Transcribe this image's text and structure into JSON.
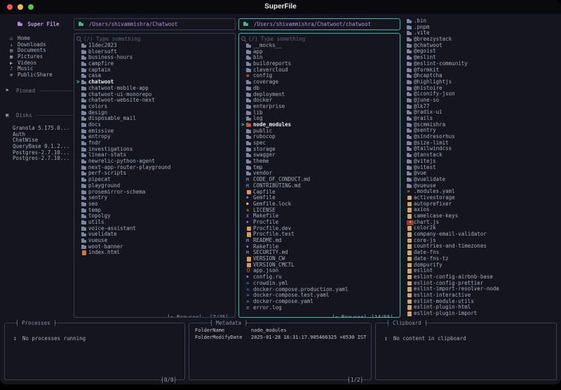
{
  "window": {
    "title": "SuperFile"
  },
  "colors": {
    "accent": "#3eb8ac",
    "path_text": "#b093e6",
    "folder": "#7d87a0",
    "red_folder": "#c2504a",
    "traffic_red": "#f5574e",
    "traffic_yellow": "#f5bd4f",
    "traffic_green": "#57c353"
  },
  "sidebar": {
    "title": "Super File",
    "items": [
      {
        "name": "Home",
        "icon": "home-icon"
      },
      {
        "name": "Downloads",
        "icon": "download-icon"
      },
      {
        "name": "Documents",
        "icon": "document-icon"
      },
      {
        "name": "Pictures",
        "icon": "image-icon"
      },
      {
        "name": "Videos",
        "icon": "video-icon"
      },
      {
        "name": "Music",
        "icon": "music-icon"
      },
      {
        "name": "PublicShare",
        "icon": "share-icon"
      }
    ],
    "sections": [
      {
        "label": "Pinned",
        "icon": "pin-icon"
      },
      {
        "label": "Disks",
        "icon": "disk-icon"
      }
    ],
    "disks": [
      {
        "name": "Granola 5.175.0..."
      },
      {
        "name": "Auth"
      },
      {
        "name": "ChatWise"
      },
      {
        "name": "QueryBase 0.1.2..."
      },
      {
        "name": "Postgres-2.7.10..."
      },
      {
        "name": "Postgres-2.7.10..."
      }
    ]
  },
  "panel1": {
    "path": "/Users/shivammishra/Chatwoot",
    "search_placeholder": "(/) Type something",
    "mode": "Browser",
    "position": "7/35",
    "files": [
      {
        "name": "11dec2023",
        "icon": "folder-icon"
      },
      {
        "name": "bloersoft",
        "icon": "folder-icon"
      },
      {
        "name": "business-hours",
        "icon": "folder-icon"
      },
      {
        "name": "campfire",
        "icon": "folder-icon"
      },
      {
        "name": "captain",
        "icon": "folder-icon"
      },
      {
        "name": "casa",
        "icon": "folder-icon"
      },
      {
        "name": "chatwoot",
        "icon": "folder-icon",
        "selected": true
      },
      {
        "name": "chatwoot-mobile-app",
        "icon": "folder-icon"
      },
      {
        "name": "chatwoot-ui-monorepo",
        "icon": "folder-icon"
      },
      {
        "name": "chatwoot-website-next",
        "icon": "folder-icon"
      },
      {
        "name": "colors",
        "icon": "folder-icon"
      },
      {
        "name": "design",
        "icon": "folder-icon"
      },
      {
        "name": "disposable_mail",
        "icon": "folder-icon"
      },
      {
        "name": "docs",
        "icon": "folder-icon"
      },
      {
        "name": "emissive",
        "icon": "folder-icon"
      },
      {
        "name": "entropy",
        "icon": "folder-icon"
      },
      {
        "name": "fndr",
        "icon": "folder-icon"
      },
      {
        "name": "investigations",
        "icon": "folder-icon"
      },
      {
        "name": "linear-stats",
        "icon": "folder-icon"
      },
      {
        "name": "newrelic-python-agent",
        "icon": "folder-icon"
      },
      {
        "name": "next-app-router-playground",
        "icon": "folder-icon"
      },
      {
        "name": "perf-scripts",
        "icon": "folder-icon"
      },
      {
        "name": "pipecat",
        "icon": "folder-icon"
      },
      {
        "name": "playground",
        "icon": "folder-icon"
      },
      {
        "name": "prosemirror-schema",
        "icon": "folder-icon"
      },
      {
        "name": "sentry",
        "icon": "folder-icon"
      },
      {
        "name": "seo",
        "icon": "folder-icon"
      },
      {
        "name": "temp",
        "icon": "folder-icon"
      },
      {
        "name": "topolgy",
        "icon": "folder-icon"
      },
      {
        "name": "utils",
        "icon": "folder-icon"
      },
      {
        "name": "voice-assistant",
        "icon": "folder-icon"
      },
      {
        "name": "vuelidate",
        "icon": "folder-icon"
      },
      {
        "name": "vueuse",
        "icon": "folder-icon"
      },
      {
        "name": "woot-banner",
        "icon": "folder-icon"
      },
      {
        "name": "index.html",
        "icon": "html-icon"
      }
    ]
  },
  "panel2": {
    "path": "/Users/shivammishra/Chatwoot/chatwoot",
    "search_placeholder": "(/) Type something",
    "mode": "Browser",
    "position": "14/55",
    "files": [
      {
        "name": "__mocks__",
        "icon": "folder-icon"
      },
      {
        "name": "app",
        "icon": "folder-icon"
      },
      {
        "name": "bin",
        "icon": "folder-icon"
      },
      {
        "name": "buildreports",
        "icon": "folder-icon"
      },
      {
        "name": "clevercloud",
        "icon": "folder-icon"
      },
      {
        "name": "config",
        "icon": "gear-icon"
      },
      {
        "name": "coverage",
        "icon": "folder-icon"
      },
      {
        "name": "db",
        "icon": "folder-icon"
      },
      {
        "name": "deployment",
        "icon": "folder-icon"
      },
      {
        "name": "docker",
        "icon": "folder-icon"
      },
      {
        "name": "enterprise",
        "icon": "folder-icon"
      },
      {
        "name": "lib",
        "icon": "folder-icon"
      },
      {
        "name": "log",
        "icon": "folder-icon"
      },
      {
        "name": "node_modules",
        "icon": "red-folder-icon",
        "selected": true
      },
      {
        "name": "public",
        "icon": "folder-icon"
      },
      {
        "name": "rubocop",
        "icon": "folder-icon"
      },
      {
        "name": "spec",
        "icon": "folder-icon"
      },
      {
        "name": "storage",
        "icon": "folder-icon"
      },
      {
        "name": "swagger",
        "icon": "folder-icon"
      },
      {
        "name": "theme",
        "icon": "folder-icon"
      },
      {
        "name": "tmp",
        "icon": "folder-icon"
      },
      {
        "name": "vendor",
        "icon": "folder-icon"
      },
      {
        "name": "CODE_OF_CONDUCT.md",
        "icon": "markdown-icon"
      },
      {
        "name": "CONTRIBUTING.md",
        "icon": "markdown-icon"
      },
      {
        "name": "Capfile",
        "icon": "file-icon"
      },
      {
        "name": "Gemfile",
        "icon": "gem-icon"
      },
      {
        "name": "Gemfile.lock",
        "icon": "lock-icon"
      },
      {
        "name": "LICENSE",
        "icon": "key-icon"
      },
      {
        "name": "Makefile",
        "icon": "makefile-icon"
      },
      {
        "name": "Procfile",
        "icon": "gem-icon"
      },
      {
        "name": "Procfile.dev",
        "icon": "file-icon"
      },
      {
        "name": "Procfile.test",
        "icon": "file-icon"
      },
      {
        "name": "README.md",
        "icon": "markdown-icon"
      },
      {
        "name": "Rakefile",
        "icon": "gem-icon"
      },
      {
        "name": "SECURITY.md",
        "icon": "markdown-icon"
      },
      {
        "name": "VERSION_CW",
        "icon": "file-icon"
      },
      {
        "name": "VERSION_CMCTL",
        "icon": "file-icon"
      },
      {
        "name": "app.json",
        "icon": "json-icon"
      },
      {
        "name": "config.ru",
        "icon": "gem-icon"
      },
      {
        "name": "crowdin.yml",
        "icon": "yaml-icon"
      },
      {
        "name": "docker-compose.production.yaml",
        "icon": "yaml-icon"
      },
      {
        "name": "docker-compose.test.yaml",
        "icon": "yaml-icon"
      },
      {
        "name": "docker-compose.yaml",
        "icon": "yaml-icon"
      },
      {
        "name": "error.log",
        "icon": "log-icon"
      }
    ]
  },
  "preview": {
    "files": [
      {
        "name": ".bin",
        "icon": "folder-icon"
      },
      {
        "name": ".pnpm",
        "icon": "folder-icon"
      },
      {
        "name": ".vite",
        "icon": "folder-icon"
      },
      {
        "name": "@breezystack",
        "icon": "folder-icon"
      },
      {
        "name": "@chatwoot",
        "icon": "folder-icon"
      },
      {
        "name": "@egoist",
        "icon": "folder-icon"
      },
      {
        "name": "@eslint",
        "icon": "folder-icon"
      },
      {
        "name": "@eslint-community",
        "icon": "folder-icon"
      },
      {
        "name": "@formkit",
        "icon": "folder-icon"
      },
      {
        "name": "@hcaptcha",
        "icon": "folder-icon"
      },
      {
        "name": "@highlightjs",
        "icon": "folder-icon"
      },
      {
        "name": "@histoire",
        "icon": "folder-icon"
      },
      {
        "name": "@iconify-json",
        "icon": "folder-icon"
      },
      {
        "name": "@june-so",
        "icon": "folder-icon"
      },
      {
        "name": "@lk77",
        "icon": "folder-icon"
      },
      {
        "name": "@radix-ui",
        "icon": "folder-icon"
      },
      {
        "name": "@rails",
        "icon": "folder-icon"
      },
      {
        "name": "@scmmishra",
        "icon": "folder-icon"
      },
      {
        "name": "@sentry",
        "icon": "folder-icon"
      },
      {
        "name": "@sindresorhus",
        "icon": "folder-icon"
      },
      {
        "name": "@size-limit",
        "icon": "folder-icon"
      },
      {
        "name": "@tailwindcss",
        "icon": "folder-icon"
      },
      {
        "name": "@tanstack",
        "icon": "folder-icon"
      },
      {
        "name": "@vitejs",
        "icon": "folder-icon"
      },
      {
        "name": "@vitest",
        "icon": "folder-icon"
      },
      {
        "name": "@vue",
        "icon": "folder-icon"
      },
      {
        "name": "@vuelidate",
        "icon": "folder-icon"
      },
      {
        "name": "@vueuse",
        "icon": "folder-icon"
      },
      {
        "name": ".modules.yaml",
        "icon": "yaml-orange-icon"
      },
      {
        "name": "activestorage",
        "icon": "pkg-icon"
      },
      {
        "name": "autoprefixer",
        "icon": "pkg-icon"
      },
      {
        "name": "axios",
        "icon": "pkg-icon"
      },
      {
        "name": "camelcase-keys",
        "icon": "pkg-icon"
      },
      {
        "name": "chart.js",
        "icon": "npm-icon"
      },
      {
        "name": "color2k",
        "icon": "pkg-icon"
      },
      {
        "name": "company-email-validator",
        "icon": "pkg-icon"
      },
      {
        "name": "core-js",
        "icon": "pkg-icon"
      },
      {
        "name": "countries-and-timezones",
        "icon": "pkg-icon"
      },
      {
        "name": "date-fns",
        "icon": "pkg-icon"
      },
      {
        "name": "date-fns-tz",
        "icon": "pkg-icon"
      },
      {
        "name": "dompurify",
        "icon": "pkg-icon"
      },
      {
        "name": "eslint",
        "icon": "pkg-icon"
      },
      {
        "name": "eslint-config-airbnb-base",
        "icon": "pkg-icon"
      },
      {
        "name": "eslint-config-prettier",
        "icon": "pkg-icon"
      },
      {
        "name": "eslint-import-resolver-node",
        "icon": "pkg-icon"
      },
      {
        "name": "eslint-interactive",
        "icon": "pkg-icon"
      },
      {
        "name": "eslint-module-utils",
        "icon": "pkg-icon"
      },
      {
        "name": "eslint-plugin-html",
        "icon": "pkg-icon"
      },
      {
        "name": "eslint-plugin-import",
        "icon": "pkg-icon"
      }
    ]
  },
  "processes": {
    "title": "Processes",
    "empty": "No processes running",
    "counter": "0/0"
  },
  "metadata": {
    "title": "Metadata",
    "rows": [
      {
        "key": "FolderName",
        "value": "node_modules"
      },
      {
        "key": "FolderModifyDate",
        "value": "2025-01-28 16:31:17.905466325 +0530 IST"
      }
    ],
    "counter": "1/2"
  },
  "clipboard": {
    "title": "Clipboard",
    "empty": "No content in clipboard"
  },
  "icons": {
    "home-icon": {
      "glyph": "⌂",
      "class": "sic"
    },
    "download-icon": {
      "glyph": "↓",
      "class": "sic"
    },
    "document-icon": {
      "glyph": "▤",
      "class": "sic"
    },
    "image-icon": {
      "glyph": "▦",
      "class": "sic"
    },
    "video-icon": {
      "glyph": "▶",
      "class": "sic"
    },
    "music-icon": {
      "glyph": "♪",
      "class": "sic"
    },
    "share-icon": {
      "glyph": "⊕",
      "class": "sic"
    },
    "pin-icon": {
      "glyph": "⚑",
      "class": "sic"
    },
    "disk-icon": {
      "glyph": "▣",
      "class": "sic"
    },
    "folder-icon": {
      "glyph": "",
      "class": "fold"
    },
    "red-folder-icon": {
      "glyph": "",
      "class": "fold red"
    },
    "gear-icon": {
      "glyph": "⊛",
      "class": "gear"
    },
    "markdown-icon": {
      "glyph": "M",
      "class": "md"
    },
    "gem-icon": {
      "glyph": "◆",
      "class": "gem"
    },
    "lock-icon": {
      "glyph": "●",
      "class": "lock"
    },
    "key-icon": {
      "glyph": "¤",
      "class": "key"
    },
    "makefile-icon": {
      "glyph": "X",
      "class": "mk"
    },
    "file-icon": {
      "glyph": "",
      "class": "rect orange"
    },
    "json-icon": {
      "glyph": "{}",
      "class": "jsn"
    },
    "yaml-icon": {
      "glyph": "»",
      "class": "yml"
    },
    "yaml-orange-icon": {
      "glyph": "»",
      "class": "ymlo"
    },
    "log-icon": {
      "glyph": "≡",
      "class": "lg"
    },
    "html-icon": {
      "glyph": "",
      "class": "rect html"
    },
    "pkg-icon": {
      "glyph": "",
      "class": "rect pkg"
    },
    "npm-icon": {
      "glyph": "n",
      "class": "npm"
    }
  }
}
